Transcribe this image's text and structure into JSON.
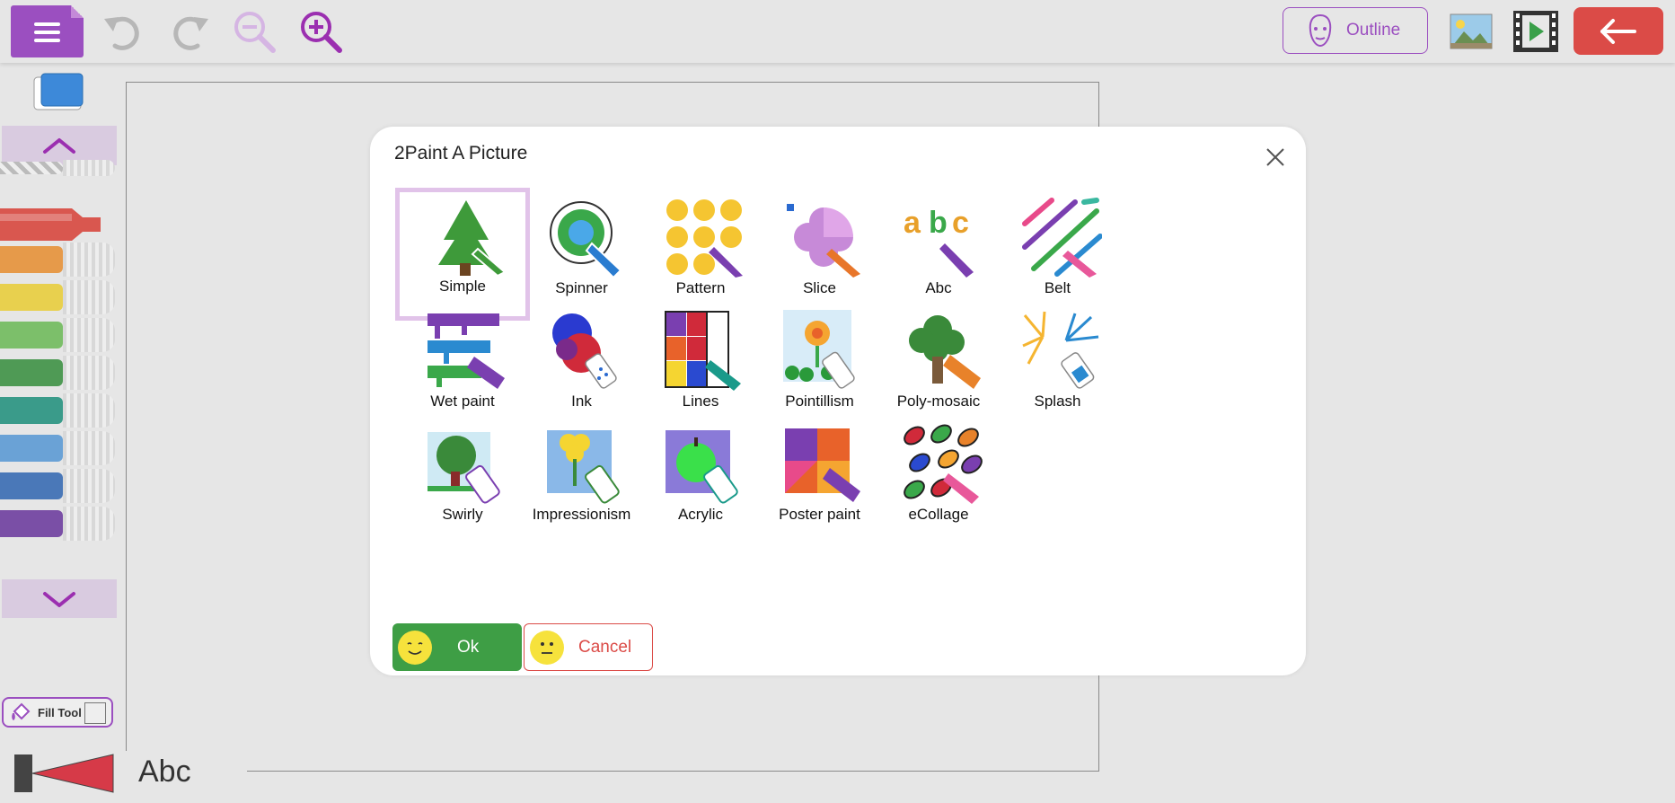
{
  "toolbar": {
    "menu_icon": "hamburger-menu-icon",
    "undo_icon": "undo-icon",
    "redo_icon": "redo-icon",
    "zoom_out_icon": "zoom-out-icon",
    "zoom_in_icon": "zoom-in-icon",
    "outline_label": "Outline",
    "image_icon": "picture-icon",
    "video_icon": "film-play-icon",
    "back_icon": "arrow-left-icon"
  },
  "colors": {
    "accent": "#9b4fc0",
    "danger": "#db4b47",
    "ok": "#3e9e45"
  },
  "palette": {
    "pens": [
      "#cfcfcf",
      "#d9574f",
      "#e69a4a",
      "#e8d04e",
      "#7cbf6a",
      "#4f9a55",
      "#3a9b8a",
      "#6aa2d6",
      "#4a78b8",
      "#7a4fa6"
    ]
  },
  "fill_tool": {
    "label": "Fill Tool"
  },
  "brush_preview": {
    "text": "Abc"
  },
  "dialog": {
    "title": "2Paint A Picture",
    "options": [
      {
        "label": "Simple",
        "icon": "tree-icon",
        "selected": true
      },
      {
        "label": "Spinner",
        "icon": "spinner-icon"
      },
      {
        "label": "Pattern",
        "icon": "smiley-pattern-icon"
      },
      {
        "label": "Slice",
        "icon": "slice-flower-icon"
      },
      {
        "label": "Abc",
        "icon": "abc-text-icon"
      },
      {
        "label": "Belt",
        "icon": "stripes-icon"
      },
      {
        "label": "Wet paint",
        "icon": "drips-icon"
      },
      {
        "label": "Ink",
        "icon": "ink-blot-icon"
      },
      {
        "label": "Lines",
        "icon": "mondrian-grid-icon"
      },
      {
        "label": "Pointillism",
        "icon": "dots-flower-icon"
      },
      {
        "label": "Poly-mosaic",
        "icon": "mosaic-tree-icon"
      },
      {
        "label": "Splash",
        "icon": "splash-icon"
      },
      {
        "label": "Swirly",
        "icon": "swirly-tree-icon"
      },
      {
        "label": "Impressionism",
        "icon": "impressionist-flower-icon"
      },
      {
        "label": "Acrylic",
        "icon": "acrylic-apple-icon"
      },
      {
        "label": "Poster paint",
        "icon": "poster-paint-icon"
      },
      {
        "label": "eCollage",
        "icon": "leaf-collage-icon"
      }
    ],
    "ok_label": "Ok",
    "cancel_label": "Cancel"
  }
}
